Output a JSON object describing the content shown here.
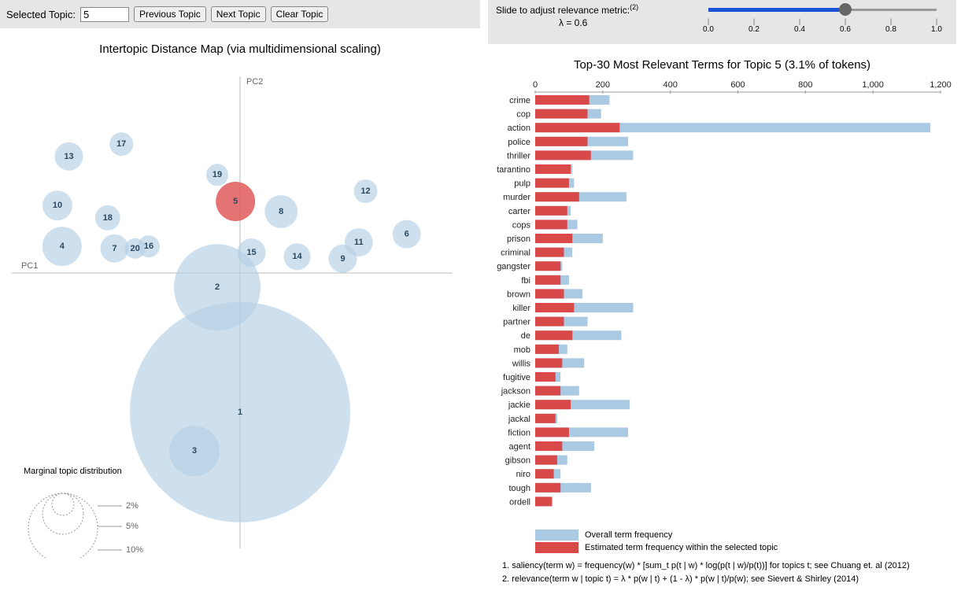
{
  "toolbar": {
    "selected_label": "Selected Topic:",
    "selected_value": "5",
    "prev_label": "Previous Topic",
    "next_label": "Next Topic",
    "clear_label": "Clear Topic"
  },
  "slider": {
    "descr": "Slide to adjust relevance metric:",
    "sup": "(2)",
    "lambda_label": "λ = 0.6",
    "value": 0.6,
    "ticks": [
      "0.0",
      "0.2",
      "0.4",
      "0.6",
      "0.8",
      "1.0"
    ]
  },
  "left_title": "Intertopic Distance Map (via multidimensional scaling)",
  "right_title": "Top-30 Most Relevant Terms for Topic 5 (3.1% of tokens)",
  "axes": {
    "pc1": "PC1",
    "pc2": "PC2"
  },
  "marginal_label": "Marginal topic distribution",
  "marginal_levels": [
    "2%",
    "5%",
    "10%"
  ],
  "legend": {
    "overall": "Overall term frequency",
    "topic": "Estimated term frequency within the selected topic"
  },
  "footnotes": [
    "1. saliency(term w) = frequency(w) * [sum_t p(t | w) * log(p(t | w)/p(t))] for topics t; see Chuang et. al (2012)",
    "2. relevance(term w | topic t) = λ * p(w | t) + (1 - λ) * p(w | t)/p(w); see Sievert & Shirley (2014)"
  ],
  "chart_data": {
    "bubbles": {
      "type": "scatter-bubble",
      "x_axis": "PC1",
      "y_axis": "PC2",
      "selected": 5,
      "points": [
        {
          "id": 1,
          "x": 0.0,
          "y": -0.68,
          "r": 140
        },
        {
          "id": 2,
          "x": -0.1,
          "y": -0.07,
          "r": 55
        },
        {
          "id": 3,
          "x": -0.2,
          "y": -0.87,
          "r": 32
        },
        {
          "id": 4,
          "x": -0.78,
          "y": 0.13,
          "r": 25
        },
        {
          "id": 5,
          "x": -0.02,
          "y": 0.35,
          "r": 25
        },
        {
          "id": 6,
          "x": 0.73,
          "y": 0.19,
          "r": 18
        },
        {
          "id": 7,
          "x": -0.55,
          "y": 0.12,
          "r": 18
        },
        {
          "id": 8,
          "x": 0.18,
          "y": 0.3,
          "r": 21
        },
        {
          "id": 9,
          "x": 0.45,
          "y": 0.07,
          "r": 18
        },
        {
          "id": 10,
          "x": -0.8,
          "y": 0.33,
          "r": 19
        },
        {
          "id": 11,
          "x": 0.52,
          "y": 0.15,
          "r": 18
        },
        {
          "id": 12,
          "x": 0.55,
          "y": 0.4,
          "r": 15
        },
        {
          "id": 13,
          "x": -0.75,
          "y": 0.57,
          "r": 18
        },
        {
          "id": 14,
          "x": 0.25,
          "y": 0.08,
          "r": 17
        },
        {
          "id": 15,
          "x": 0.05,
          "y": 0.1,
          "r": 18
        },
        {
          "id": 16,
          "x": -0.4,
          "y": 0.13,
          "r": 14
        },
        {
          "id": 17,
          "x": -0.52,
          "y": 0.63,
          "r": 15
        },
        {
          "id": 18,
          "x": -0.58,
          "y": 0.27,
          "r": 16
        },
        {
          "id": 19,
          "x": -0.1,
          "y": 0.48,
          "r": 14
        },
        {
          "id": 20,
          "x": -0.46,
          "y": 0.12,
          "r": 13
        }
      ]
    },
    "bars": {
      "type": "bar",
      "xlabel": "",
      "ylabel": "",
      "xlim": [
        0,
        1200
      ],
      "ticks": [
        0,
        200,
        400,
        600,
        800,
        1000,
        1200
      ],
      "series_names": [
        "overall",
        "topic"
      ],
      "terms": [
        {
          "term": "crime",
          "overall": 220,
          "topic": 160
        },
        {
          "term": "cop",
          "overall": 195,
          "topic": 155
        },
        {
          "term": "action",
          "overall": 1170,
          "topic": 250
        },
        {
          "term": "police",
          "overall": 275,
          "topic": 155
        },
        {
          "term": "thriller",
          "overall": 290,
          "topic": 165
        },
        {
          "term": "tarantino",
          "overall": 110,
          "topic": 105
        },
        {
          "term": "pulp",
          "overall": 115,
          "topic": 100
        },
        {
          "term": "murder",
          "overall": 270,
          "topic": 130
        },
        {
          "term": "carter",
          "overall": 105,
          "topic": 95
        },
        {
          "term": "cops",
          "overall": 125,
          "topic": 95
        },
        {
          "term": "prison",
          "overall": 200,
          "topic": 110
        },
        {
          "term": "criminal",
          "overall": 110,
          "topic": 85
        },
        {
          "term": "gangster",
          "overall": 80,
          "topic": 75
        },
        {
          "term": "fbi",
          "overall": 100,
          "topic": 75
        },
        {
          "term": "brown",
          "overall": 140,
          "topic": 85
        },
        {
          "term": "killer",
          "overall": 290,
          "topic": 115
        },
        {
          "term": "partner",
          "overall": 155,
          "topic": 85
        },
        {
          "term": "de",
          "overall": 255,
          "topic": 110
        },
        {
          "term": "mob",
          "overall": 95,
          "topic": 70
        },
        {
          "term": "willis",
          "overall": 145,
          "topic": 80
        },
        {
          "term": "fugitive",
          "overall": 75,
          "topic": 60
        },
        {
          "term": "jackson",
          "overall": 130,
          "topic": 75
        },
        {
          "term": "jackie",
          "overall": 280,
          "topic": 105
        },
        {
          "term": "jackal",
          "overall": 65,
          "topic": 60
        },
        {
          "term": "fiction",
          "overall": 275,
          "topic": 100
        },
        {
          "term": "agent",
          "overall": 175,
          "topic": 80
        },
        {
          "term": "gibson",
          "overall": 95,
          "topic": 65
        },
        {
          "term": "niro",
          "overall": 75,
          "topic": 55
        },
        {
          "term": "tough",
          "overall": 165,
          "topic": 75
        },
        {
          "term": "ordell",
          "overall": 50,
          "topic": 50
        }
      ]
    }
  }
}
